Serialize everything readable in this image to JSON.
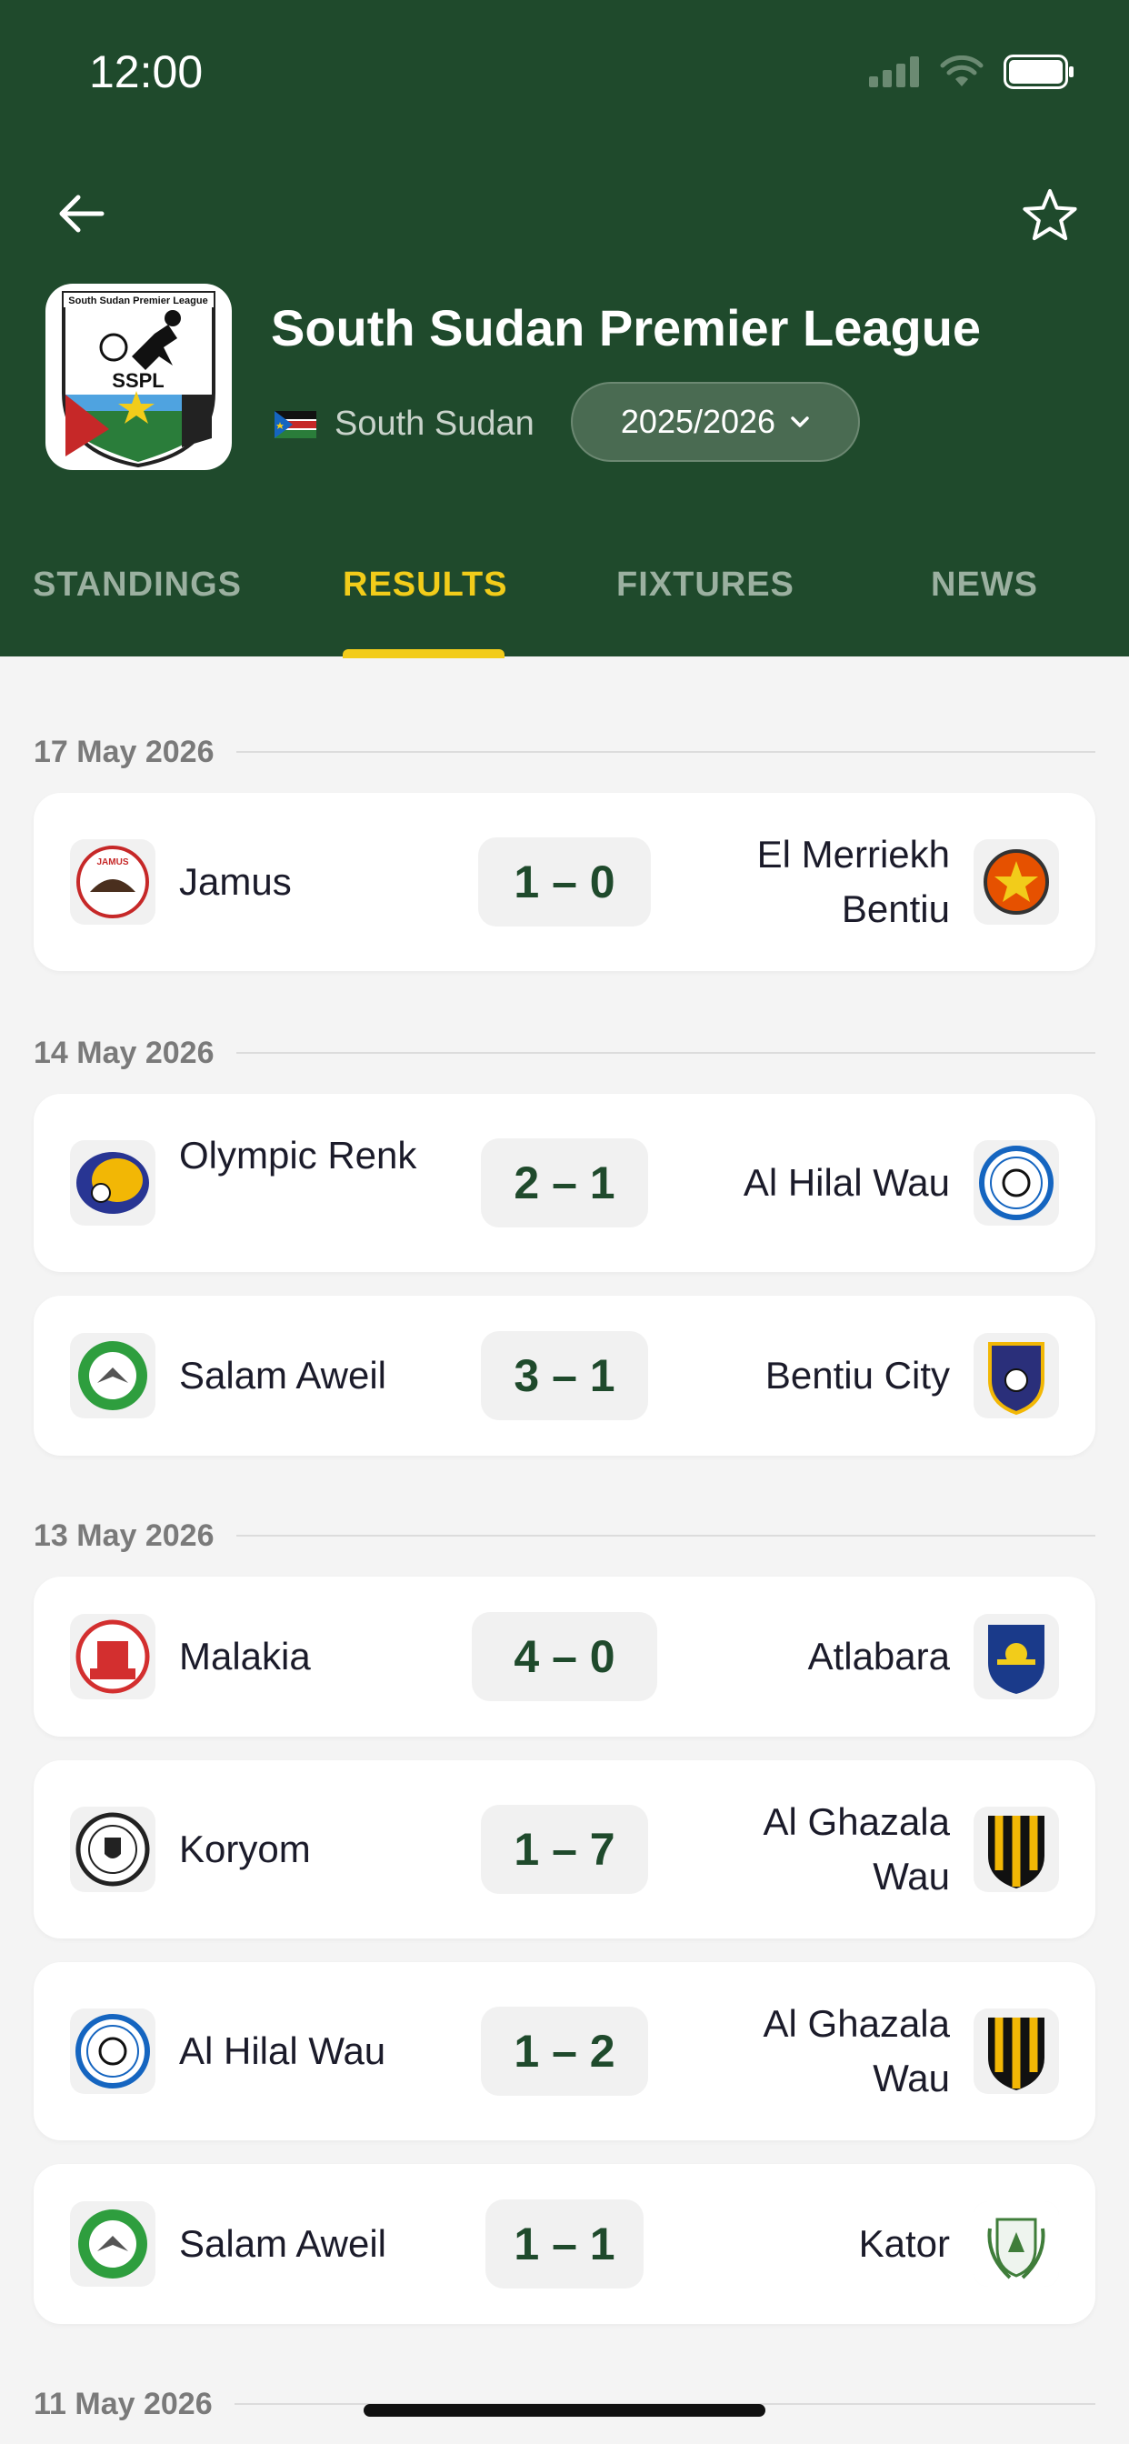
{
  "status_bar": {
    "time": "12:00"
  },
  "header": {
    "league_name": "South Sudan Premier League",
    "country": "South Sudan",
    "season": "2025/2026",
    "logo_text_top": "South Sudan Premier League",
    "logo_text_abbr": "SSPL"
  },
  "tabs": [
    {
      "label": "STANDINGS"
    },
    {
      "label": "RESULTS"
    },
    {
      "label": "FIXTURES"
    },
    {
      "label": "NEWS"
    }
  ],
  "active_tab": "RESULTS",
  "results": {
    "groups": [
      {
        "date": "17 May 2026",
        "matches": [
          {
            "home": "Jamus",
            "score": "1 – 0",
            "away": "El Merriekh Bentiu",
            "home_color": "#c62828",
            "away_color": "#e65100"
          }
        ]
      },
      {
        "date": "14 May 2026",
        "matches": [
          {
            "home": "Olympic Renk",
            "score": "2 – 1",
            "away": "Al Hilal Wau",
            "home_color": "#283593",
            "away_color": "#1565c0"
          },
          {
            "home": "Salam Aweil",
            "score": "3 – 1",
            "away": "Bentiu City",
            "home_color": "#2e9e3e",
            "away_color": "#2a2f7a"
          }
        ]
      },
      {
        "date": "13 May 2026",
        "matches": [
          {
            "home": "Malakia",
            "score": "4 – 0",
            "away": "Atlabara",
            "home_color": "#d32f2f",
            "away_color": "#1a3a8a"
          },
          {
            "home": "Koryom",
            "score": "1 – 7",
            "away": "Al Ghazala Wau",
            "home_color": "#222222",
            "away_color": "#f2b705"
          },
          {
            "home": "Al Hilal Wau",
            "score": "1 – 2",
            "away": "Al Ghazala Wau",
            "home_color": "#1565c0",
            "away_color": "#f2b705"
          },
          {
            "home": "Salam Aweil",
            "score": "1 – 1",
            "away": "Kator",
            "home_color": "#2e9e3e",
            "away_color": "#3f7d3a"
          }
        ]
      },
      {
        "date": "11 May 2026",
        "matches": []
      }
    ]
  },
  "colors": {
    "header_bg": "#1f4a2c",
    "accent": "#f2cc1a",
    "score_text": "#1f4a2c"
  }
}
